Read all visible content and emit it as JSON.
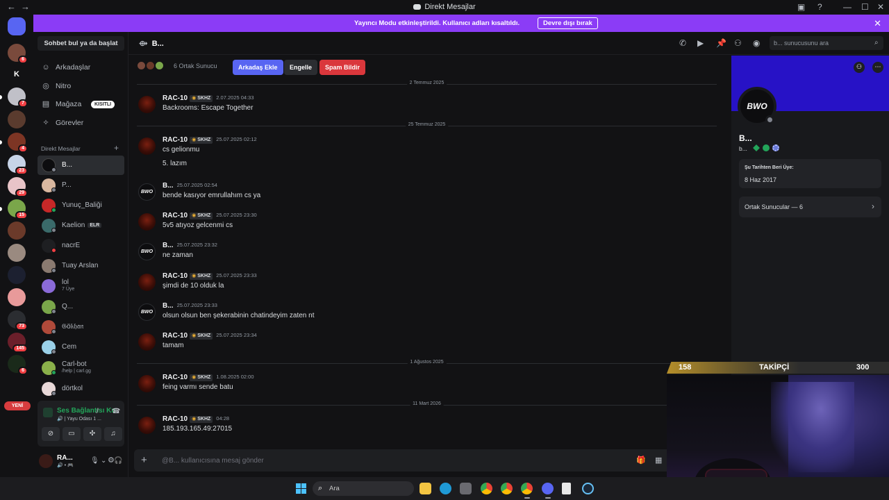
{
  "window": {
    "title": "Direkt Mesajlar",
    "back": "←",
    "forward": "→",
    "minimize": "—",
    "maximize": "☐",
    "close": "✕"
  },
  "banner": {
    "text": "Yayıncı Modu etkinleştirildi. Kullanıcı adları kısaltıldı.",
    "button": "Devre dışı bırak",
    "close": "✕"
  },
  "rail": {
    "home_label": "Direkt Mesajlar",
    "k_label": "K",
    "badges": [
      "6",
      "7",
      "4",
      "23",
      "29",
      "15",
      "73",
      "145",
      "6"
    ],
    "new_label": "YENİ"
  },
  "sidebar": {
    "find": "Sohbet bul ya da başlat",
    "nav": [
      {
        "label": "Arkadaşlar",
        "icon": "friends-icon"
      },
      {
        "label": "Nitro",
        "icon": "nitro-icon"
      },
      {
        "label": "Mağaza",
        "icon": "shop-icon",
        "badge": "KISITLI"
      },
      {
        "label": "Görevler",
        "icon": "quests-icon"
      }
    ],
    "dm_header": "Direkt Mesajlar",
    "dm_plus": "+",
    "dms": [
      {
        "name": "B...",
        "active": true
      },
      {
        "name": "P..."
      },
      {
        "name": "Yunuç_Baliği"
      },
      {
        "name": "Kaelion",
        "tag": "ELR"
      },
      {
        "name": "nacrE"
      },
      {
        "name": "Tuay Arslan"
      },
      {
        "name": "lol",
        "sub": "7 Üye"
      },
      {
        "name": "Q..."
      },
      {
        "name": "𝔊ö𝔨𝔥𝔞𝔫"
      },
      {
        "name": "Cem"
      },
      {
        "name": "Carl-bot",
        "sub": "/help | carl.gg"
      },
      {
        "name": "dörtkol"
      }
    ]
  },
  "voice": {
    "title": "Ses Bağlantısı Ku",
    "sub": "🔊 | Yayu Odası 1 ..."
  },
  "user": {
    "name": "RA...",
    "sub": "🔊 • 🎮"
  },
  "chat_header": {
    "title": "B...",
    "search_placeholder": "b... sunucusunu ara"
  },
  "intro": {
    "mutual": "6 Ortak Sunucu",
    "add_friend": "Arkadaş Ekle",
    "block": "Engelle",
    "report": "Spam Bildir"
  },
  "dividers": [
    "2 Temmuz 2025",
    "25 Temmuz 2025",
    "1 Ağustos 2025",
    "11 Mart 2026"
  ],
  "messages": [
    {
      "user": "RAC-10",
      "tag": "SKHZ",
      "time": "2.07.2025 04:33",
      "text": "Backrooms: Escape Together"
    },
    {
      "user": "RAC-10",
      "tag": "SKHZ",
      "time": "25.07.2025 02:12",
      "text": "cs gelionmu",
      "text2": "5. lazım"
    },
    {
      "user": "B...",
      "time": "25.07.2025 02:54",
      "text": "bende kasıyor emrullahım cs ya"
    },
    {
      "user": "RAC-10",
      "tag": "SKHZ",
      "time": "25.07.2025 23:30",
      "text": "5v5 atıyoz gelcenmi cs"
    },
    {
      "user": "B...",
      "time": "25.07.2025 23:32",
      "text": "ne zaman"
    },
    {
      "user": "RAC-10",
      "tag": "SKHZ",
      "time": "25.07.2025 23:33",
      "text": "şimdi de 10 olduk la"
    },
    {
      "user": "B...",
      "time": "25.07.2025 23:33",
      "text": "olsun olsun ben şekerabinin chatindeyim zaten nt"
    },
    {
      "user": "RAC-10",
      "tag": "SKHZ",
      "time": "25.07.2025 23:34",
      "text": "tamam"
    },
    {
      "user": "RAC-10",
      "tag": "SKHZ",
      "time": "1.08.2025 02:00",
      "text": "feing varmı sende batu"
    },
    {
      "user": "RAC-10",
      "tag": "SKHZ",
      "time": "04:28",
      "text": "185.193.165.49:27015"
    }
  ],
  "composer": {
    "placeholder": "@B... kullanıcısına mesaj gönder",
    "plus": "+"
  },
  "profile": {
    "avatar_text": "BWO",
    "name": "B...",
    "sub": "b...",
    "member_since_label": "Şu Tarihten Beri Üye:",
    "member_since": "8 Haz 2017",
    "mutual_servers": "Ortak Sunucular — 6"
  },
  "stream_overlay": {
    "left": "158",
    "label": "TAKİPÇİ",
    "right": "300"
  },
  "taskbar": {
    "search": "Ara"
  },
  "colors": {
    "accent": "#5865f2",
    "banner": "#8b3cf6",
    "danger": "#da373c",
    "online": "#23a55a",
    "profile_banner": "#2712c6"
  }
}
